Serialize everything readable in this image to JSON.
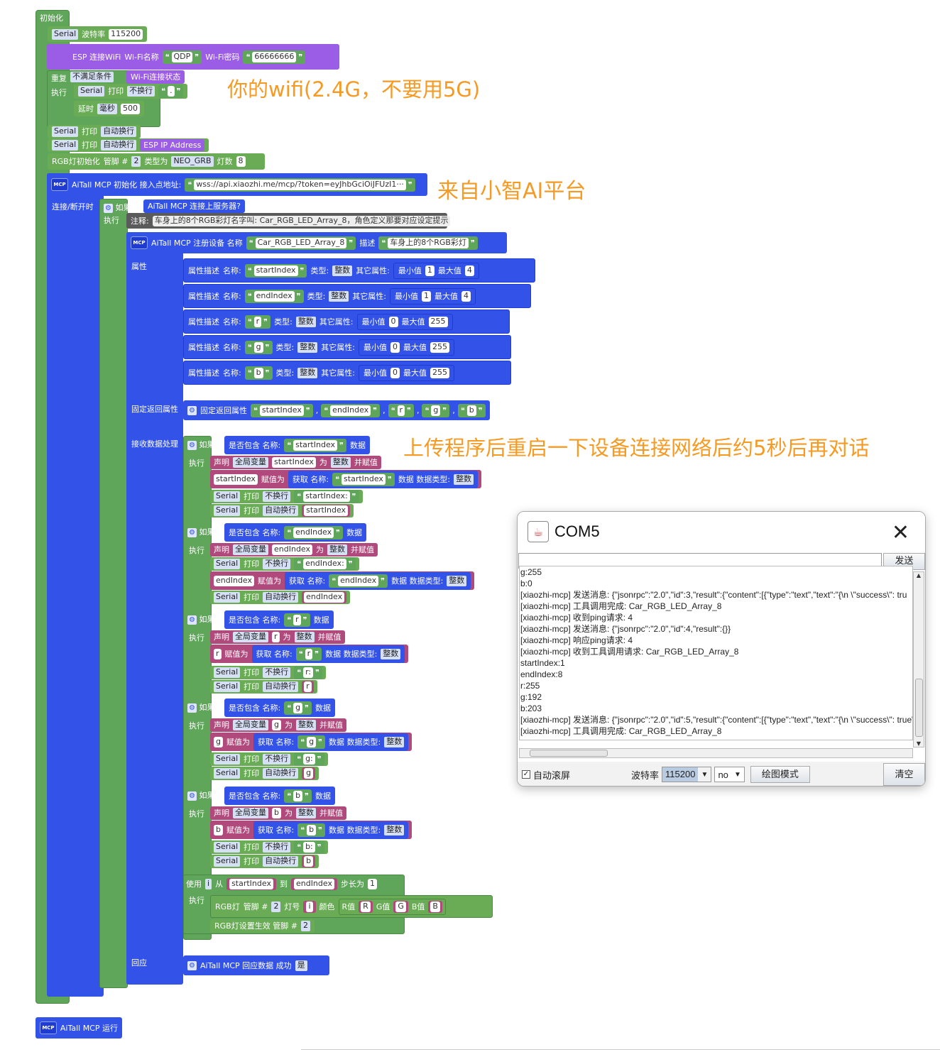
{
  "init_label": "初始化",
  "serial": "Serial",
  "baud_label": "波特率",
  "baud_value": "115200",
  "wifi": {
    "label": "ESP 连接WiFi",
    "ssid_label": "Wi-Fi名称",
    "ssid": "QDP",
    "pwd_label": "Wi-Fi密码",
    "pwd": "66666666"
  },
  "repeat": {
    "label": "重复",
    "cond": "不满足条件",
    "status": "Wi-Fi连接状态",
    "exec": "执行",
    "print": "打印",
    "no_newline": "不换行",
    "dot": ".",
    "delay": "延时",
    "ms": "毫秒",
    "ms_value": "500"
  },
  "print_newline": "自动换行",
  "ip_label": "ESP IP Address",
  "rgb_init": {
    "label": "RGB灯初始化",
    "pin_label": "管脚 #",
    "pin": "2",
    "type_label": "类型为",
    "type": "NEO_GRB",
    "count_label": "灯数",
    "count": "8"
  },
  "mcp_init": {
    "label": "AiTall MCP 初始化 接入点地址:",
    "url": "wss://api.xiaozhi.me/mcp/?token=eyJhbGciOiJFUzI1···"
  },
  "connect_label": "连接/断开时",
  "if_label": "如果",
  "connected_label": "AiTall MCP 连接上服务器?",
  "exec_label": "执行",
  "comment": {
    "label": "注释:",
    "text": "车身上的8个RGB彩灯名字叫: Car_RGB_LED_Array_8，角色定义那要对应设定提示"
  },
  "register": {
    "label": "AiTall MCP 注册设备 名称",
    "name": "Car_RGB_LED_Array_8",
    "desc_label": "描述",
    "desc": "车身上的8个RGB彩灯"
  },
  "props_label": "属性",
  "prop_desc": "属性描述",
  "name_label": "名称:",
  "type_label": "类型:",
  "int_label": "整数",
  "other_label": "其它属性:",
  "min_label": "最小值",
  "max_label": "最大值",
  "props": [
    {
      "name": "startIndex",
      "min": "1",
      "max": "4"
    },
    {
      "name": "endIndex",
      "min": "1",
      "max": "4"
    },
    {
      "name": "r",
      "min": "0",
      "max": "255"
    },
    {
      "name": "g",
      "min": "0",
      "max": "255"
    },
    {
      "name": "b",
      "min": "0",
      "max": "255"
    }
  ],
  "fixed_label": "固定返回属性",
  "fixed_block": "固定返回属性",
  "fixed": [
    "startIndex",
    "endIndex",
    "r",
    "g",
    "b"
  ],
  "comma": ",",
  "recv_label": "接收数据处理",
  "contains_label": "是否包含 名称:",
  "data_label": "数据",
  "declare_label": "声明",
  "global_label": "全局变量",
  "as_label": "为",
  "assign_label": "并赋值",
  "assign_to": "赋值为",
  "get_label": "获取 名称:",
  "dtype_label": "数据 数据类型:",
  "handlers": [
    {
      "name": "startIndex",
      "colon": "startIndex:"
    },
    {
      "name": "endIndex",
      "colon": "endIndex:"
    },
    {
      "name": "r",
      "colon": "r:"
    },
    {
      "name": "g",
      "colon": "g:"
    },
    {
      "name": "b",
      "colon": "b:"
    }
  ],
  "loop": {
    "use": "使用",
    "var": "i",
    "from": "从",
    "start": "startIndex",
    "to": "到",
    "end": "endIndex",
    "step": "步长为",
    "step_v": "1"
  },
  "rgb_set": {
    "label": "RGB灯",
    "pin": "管脚 #",
    "pin_v": "2",
    "led": "灯号",
    "color": "颜色",
    "r": "R值",
    "rv": "R",
    "g": "G值",
    "gv": "G",
    "b": "B值",
    "bv": "B"
  },
  "rgb_apply": "RGB灯设置生效 管脚 #",
  "reply_label": "回应",
  "reply_block": "AiTall MCP 回应数据 成功",
  "reply_val": "是",
  "run_label": "AiTall MCP 运行",
  "mcp_badge": "MCP",
  "annotations": [
    "你的wifi(2.4G，不要用5G)",
    "来自小智AI平台",
    "上传程序后重启一下设备连接网络后约5秒后再对话"
  ],
  "serial_window": {
    "title": "COM5",
    "send": "发送",
    "autoscroll": "自动滚屏",
    "baud_label": "波特率",
    "baud": "115200",
    "lineend": "no",
    "plot": "绘图模式",
    "clear": "清空",
    "log": [
      "g:255",
      "b:0",
      "[xiaozhi-mcp] 发送消息: {\"jsonrpc\":\"2.0\",\"id\":3,\"result\":{\"content\":[{\"type\":\"text\",\"text\":\"{\\n  \\\"success\\\": tru",
      "[xiaozhi-mcp] 工具调用完成: Car_RGB_LED_Array_8",
      "[xiaozhi-mcp] 收到ping请求: 4",
      "[xiaozhi-mcp] 发送消息: {\"jsonrpc\":\"2.0\",\"id\":4,\"result\":{}}",
      "[xiaozhi-mcp] 响应ping请求: 4",
      "[xiaozhi-mcp] 收到工具调用请求: Car_RGB_LED_Array_8",
      "startIndex:1",
      "endIndex:8",
      "r:255",
      "g:192",
      "b:203",
      "[xiaozhi-mcp] 发送消息: {\"jsonrpc\":\"2.0\",\"id\":5,\"result\":{\"content\":[{\"type\":\"text\",\"text\":\"{\\n  \\\"success\\\": true\\n",
      "[xiaozhi-mcp] 工具调用完成: Car_RGB_LED_Array_8"
    ]
  }
}
